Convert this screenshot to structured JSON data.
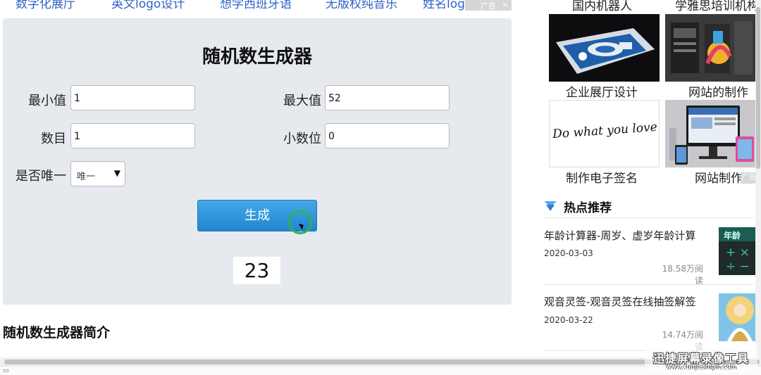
{
  "topnav": {
    "links": [
      "数字化展厅",
      "英文logo设计",
      "想学西班牙语",
      "无版权纯音乐",
      "姓名logo设计"
    ],
    "ad_labels": [
      "广告",
      "×"
    ]
  },
  "generator": {
    "title": "随机数生成器",
    "min_label": "最小值",
    "min_value": "1",
    "max_label": "最大值",
    "max_value": "52",
    "count_label": "数目",
    "count_value": "1",
    "decimals_label": "小数位",
    "decimals_value": "0",
    "unique_label": "是否唯一",
    "unique_selected": "唯一",
    "generate_label": "生成",
    "result": "23"
  },
  "intro_heading": "随机数生成器简介",
  "right_column": {
    "top_captions": [
      "国内机器人",
      "学雅思培训机构"
    ],
    "tiles": [
      {
        "caption": "企业展厅设计"
      },
      {
        "caption": "网站的制作"
      },
      {
        "caption": "制作电子签名",
        "image_text": "Do what you love"
      },
      {
        "caption": "网站制作"
      }
    ],
    "tile_ad_label": "广告",
    "hot": {
      "title": "热点推荐",
      "articles": [
        {
          "title": "年龄计算器-周岁、虚岁年龄计算",
          "date": "2020-03-03",
          "reads": "18.58万阅读",
          "thumb_text": "年龄"
        },
        {
          "title": "观音灵签-观音灵签在线抽签解签",
          "date": "2020-03-22",
          "reads": "14.74万阅读"
        }
      ]
    }
  },
  "watermark": {
    "title": "迅捷屏幕录像工具",
    "url": "www.xunjieshipin.com"
  },
  "colors": {
    "link": "#2d63c8",
    "panel_bg": "#e6eaef",
    "button": "#2a8fd6",
    "click_ring": "#2fb24c"
  }
}
